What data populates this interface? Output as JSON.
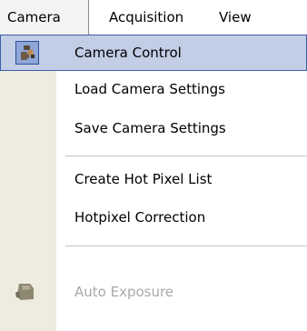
{
  "menubar": {
    "items": [
      {
        "label": "Camera"
      },
      {
        "label": "Acquisition"
      },
      {
        "label": "View"
      }
    ]
  },
  "menu": {
    "items": [
      {
        "label": "Camera Control",
        "icon": "camera-control-icon",
        "state": "selected"
      },
      {
        "label": "Load Camera Settings"
      },
      {
        "label": "Save Camera Settings"
      },
      {
        "label": "Create Hot Pixel List"
      },
      {
        "label": "Hotpixel Correction"
      },
      {
        "label": "Auto Exposure",
        "icon": "auto-exposure-icon",
        "state": "disabled"
      }
    ]
  },
  "colors": {
    "highlight": "#c2cde6",
    "highlight_border": "#3d5fa8",
    "gutter": "#edecdf",
    "disabled_text": "#a8a8a8"
  }
}
